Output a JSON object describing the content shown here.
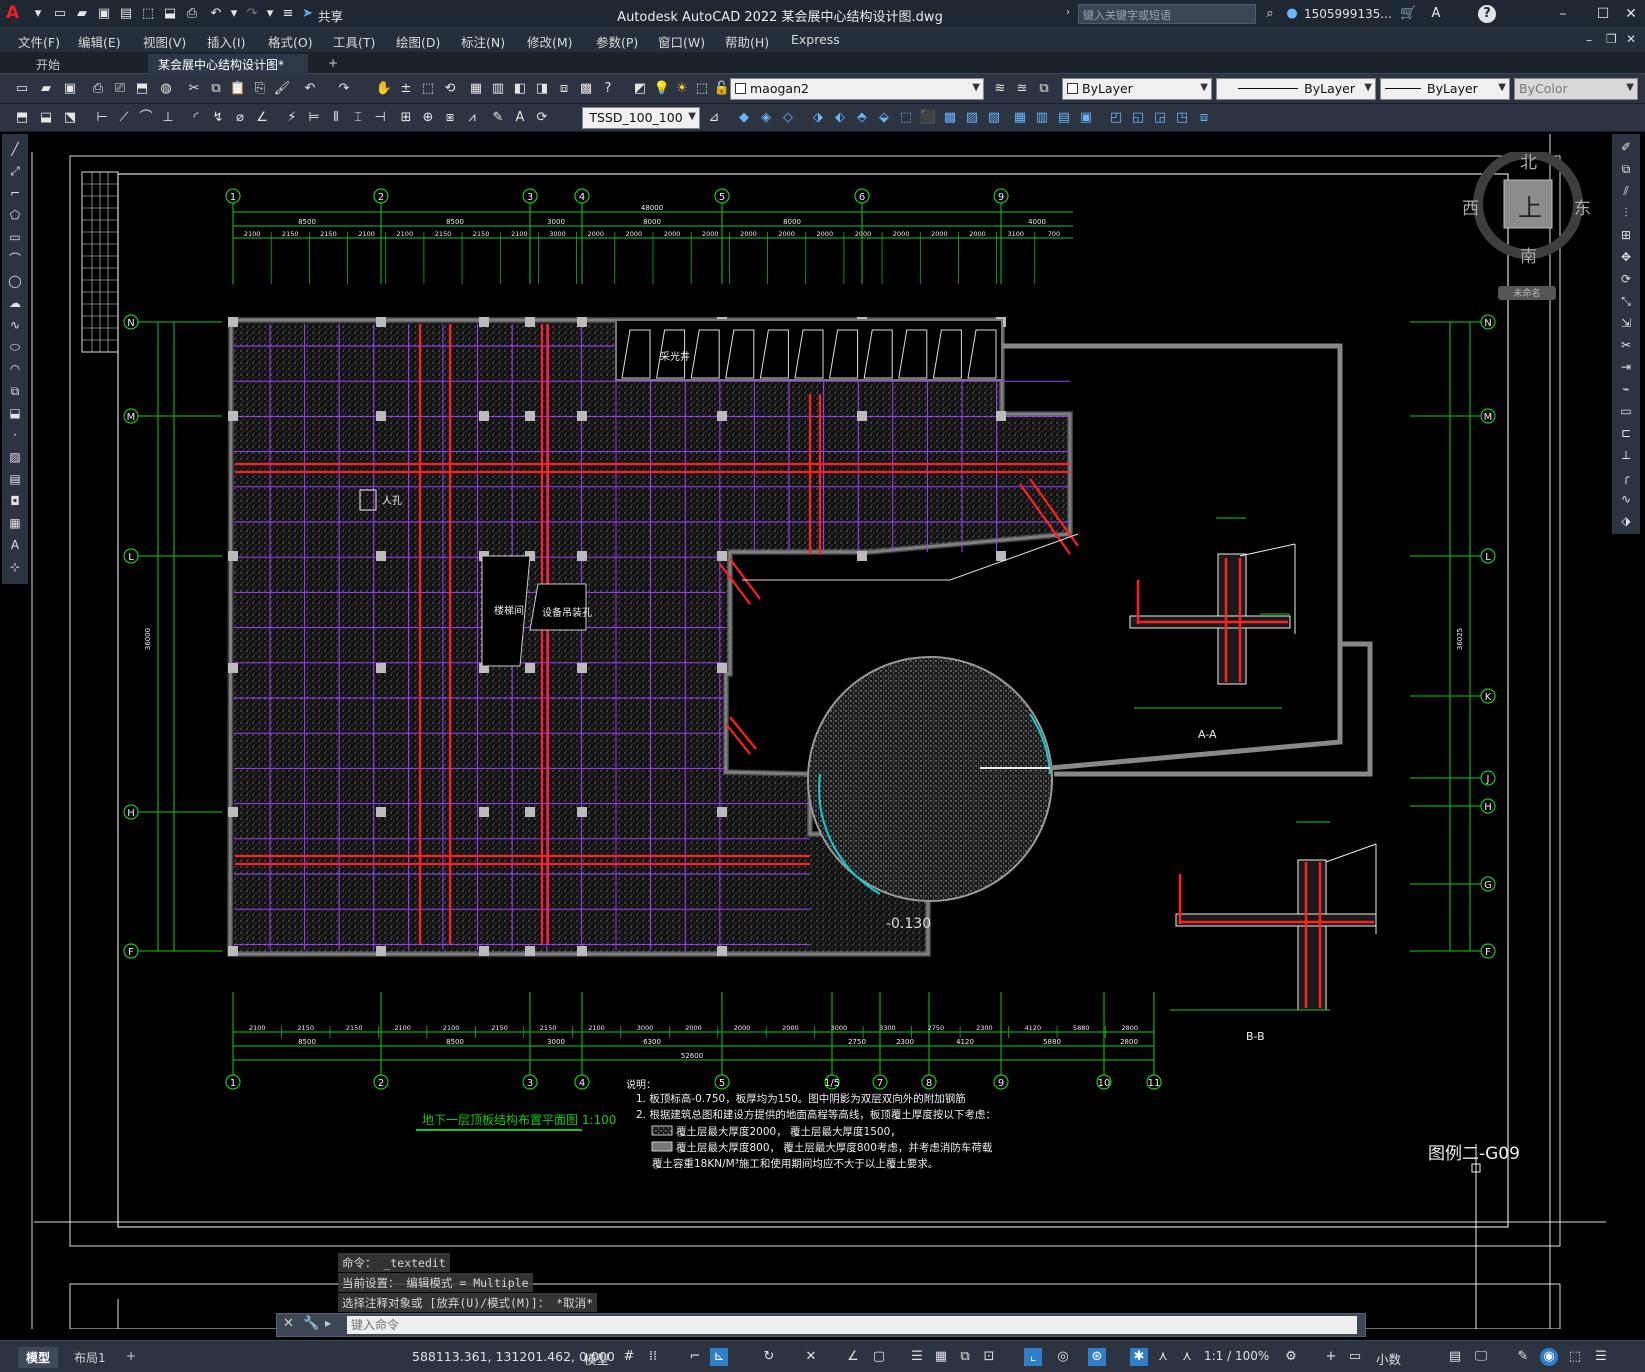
{
  "titlebar": {
    "app_letter": "A",
    "share_label": "共享",
    "title": "Autodesk AutoCAD 2022    某会展中心结构设计图.dwg",
    "search_placeholder": "键入关键字或短语",
    "user": "1505999135...",
    "help": "?"
  },
  "menu": [
    "文件(F)",
    "编辑(E)",
    "视图(V)",
    "插入(I)",
    "格式(O)",
    "工具(T)",
    "绘图(D)",
    "标注(N)",
    "修改(M)",
    "参数(P)",
    "窗口(W)",
    "帮助(H)",
    "Express"
  ],
  "tabs": {
    "start": "开始",
    "active": "某会展中心结构设计图*",
    "close": "×",
    "add": "+"
  },
  "toolbar": {
    "layer": "maogan2",
    "color": "ByLayer",
    "linetype": "ByLayer",
    "lineweight": "ByLayer",
    "plotstyle": "ByColor",
    "dimstyle": "TSSD_100_100"
  },
  "viewcube": {
    "north": "北",
    "south": "南",
    "east": "东",
    "west": "西",
    "top": "上",
    "wcs": "未命名"
  },
  "drawing": {
    "axis_top": [
      "1",
      "2",
      "3",
      "4",
      "5",
      "6",
      "9"
    ],
    "axis_bottom": [
      "1",
      "2",
      "3",
      "4",
      "5",
      "1/5",
      "7",
      "8",
      "9",
      "10",
      "11"
    ],
    "axis_left": [
      "N",
      "M",
      "L",
      "H",
      "F"
    ],
    "axis_right": [
      "N",
      "M",
      "L",
      "K",
      "J",
      "H",
      "G",
      "F"
    ],
    "top_overall": "48000",
    "top_spans": [
      "8500",
      "8500",
      "3000",
      "8000",
      "8000",
      "4000"
    ],
    "top_sub": [
      "2100",
      "2150",
      "2150",
      "2100",
      "2100",
      "2150",
      "2150",
      "2100",
      "3000",
      "2000",
      "2000",
      "2000",
      "2000",
      "2000",
      "2000",
      "2000",
      "2000",
      "2000",
      "2000",
      "2000",
      "3100",
      "700"
    ],
    "bottom_sub": [
      "2100",
      "2150",
      "2150",
      "2100",
      "2100",
      "2150",
      "2150",
      "2100",
      "3000",
      "2000",
      "2000",
      "2000",
      "3000",
      "3300",
      "2750",
      "2300",
      "4120",
      "5880",
      "2800"
    ],
    "bottom_spans": [
      "8500",
      "8500",
      "3000",
      "6300",
      "2750",
      "2300",
      "4120",
      "5880",
      "2800"
    ],
    "bottom_overall": "52600",
    "left_overall": "36000",
    "right_overall": "36025",
    "room_labels": [
      "采光井",
      "人孔",
      "楼梯间",
      "设备吊装孔"
    ],
    "elev_label": "-0.130",
    "section_aa": "A-A",
    "section_bb": "B-B",
    "plan_title": "地下一层顶板结构布置平面图 1:100",
    "notes_title": "说明：",
    "notes": [
      "1. 板顶标高-0.750，板厚均为150。图中阴影为双层双向外的附加钢筋",
      "2. 根据建筑总图和建设方提供的地面高程等高线，板顶覆土厚度按以下考虑：",
      "覆土层最大厚度2000，     覆土层最大厚度1500，",
      "覆土层最大厚度800，  覆土层最大厚度800考虑，并考虑消防车荷载",
      "覆土容重18KN/M³施工和使用期间均应不大于以上覆土要求。"
    ],
    "sheet_no": "图例二-G09"
  },
  "command": {
    "history": [
      "命令： _textedit",
      "当前设置： 编辑模式 = Multiple",
      "选择注释对象或 [放弃(U)/模式(M)]： *取消*"
    ],
    "placeholder": "键入命令"
  },
  "status": {
    "model_tab": "模型",
    "layout_tab": "布局1",
    "coords": "588113.361, 131201.462, 0.000",
    "space": "模型",
    "scale": "1:1 / 100%",
    "units": "小数"
  }
}
